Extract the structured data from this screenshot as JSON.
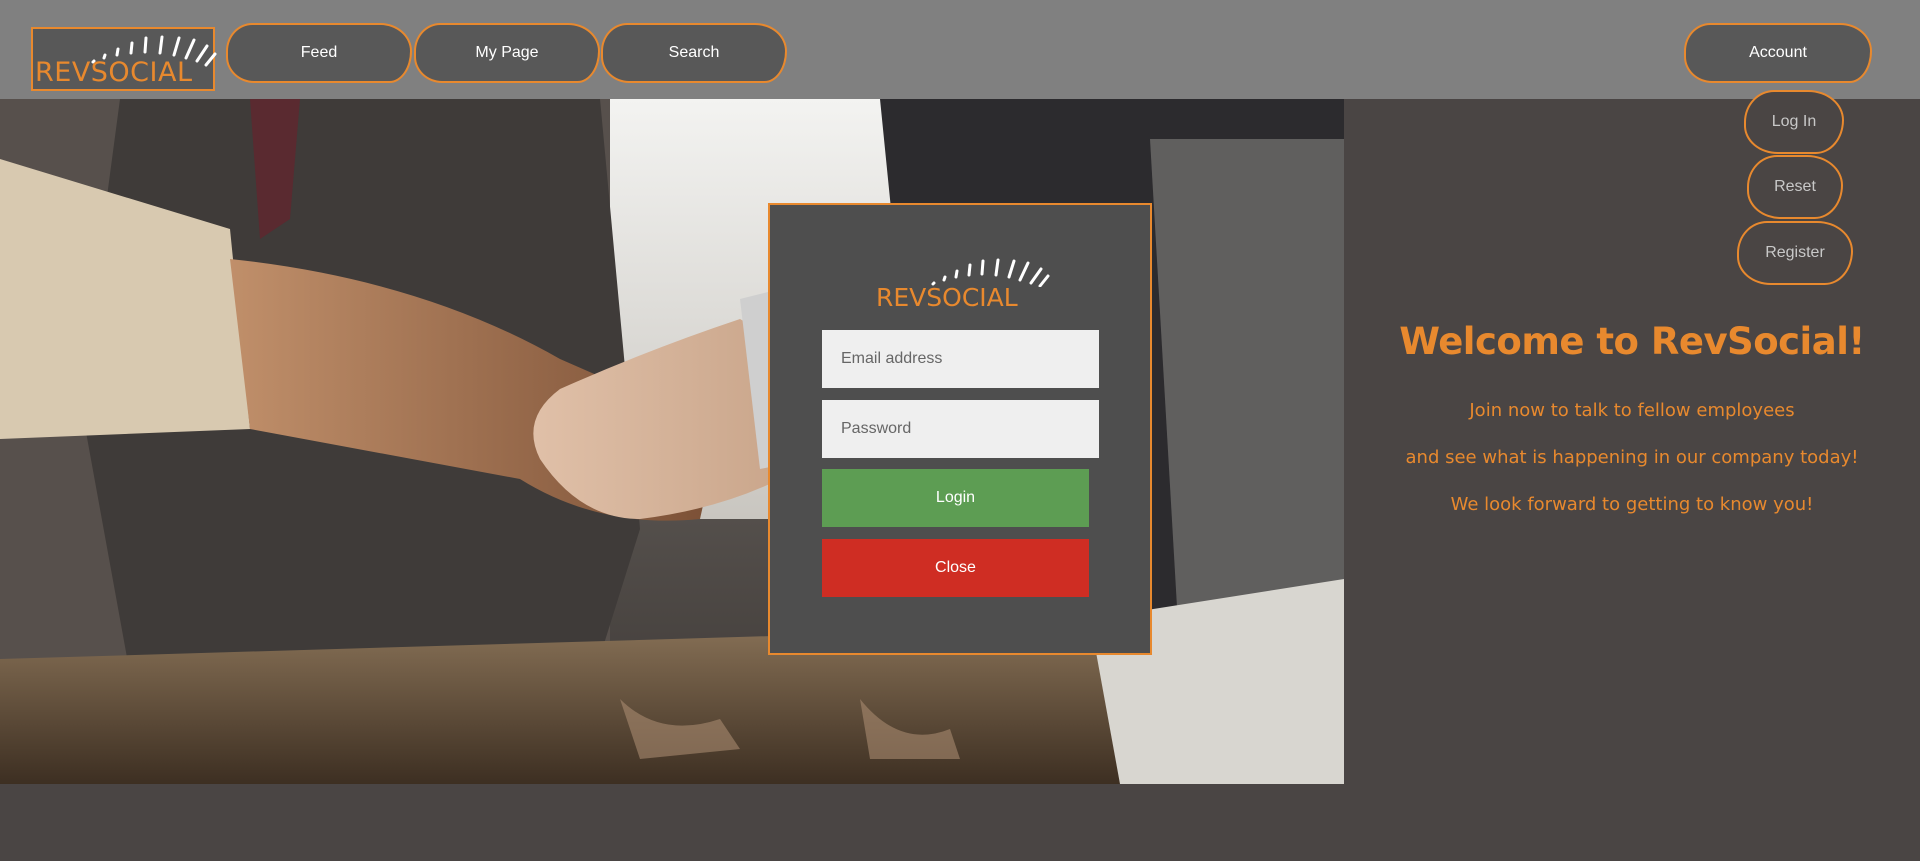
{
  "brand": {
    "logo_text": "REVSOCIAL",
    "accent_color": "#e8892e"
  },
  "nav": {
    "items": [
      {
        "label": "Feed"
      },
      {
        "label": "My Page"
      },
      {
        "label": "Search"
      }
    ],
    "account_label": "Account"
  },
  "account_menu": {
    "items": [
      {
        "label": "Log In"
      },
      {
        "label": "Reset"
      },
      {
        "label": "Register"
      }
    ]
  },
  "login_modal": {
    "logo_text": "REVSOCIAL",
    "email_placeholder": "Email address",
    "password_placeholder": "Password",
    "login_label": "Login",
    "close_label": "Close",
    "login_color": "#5d9d53",
    "close_color": "#cf2d23"
  },
  "welcome": {
    "title": "Welcome to RevSocial!",
    "lines": [
      "Join now to talk to fellow employees",
      "and see what is happening in our company today!",
      "We look forward to getting to know you!"
    ]
  },
  "hero": {
    "image_subject": "business-handshake-photo"
  }
}
